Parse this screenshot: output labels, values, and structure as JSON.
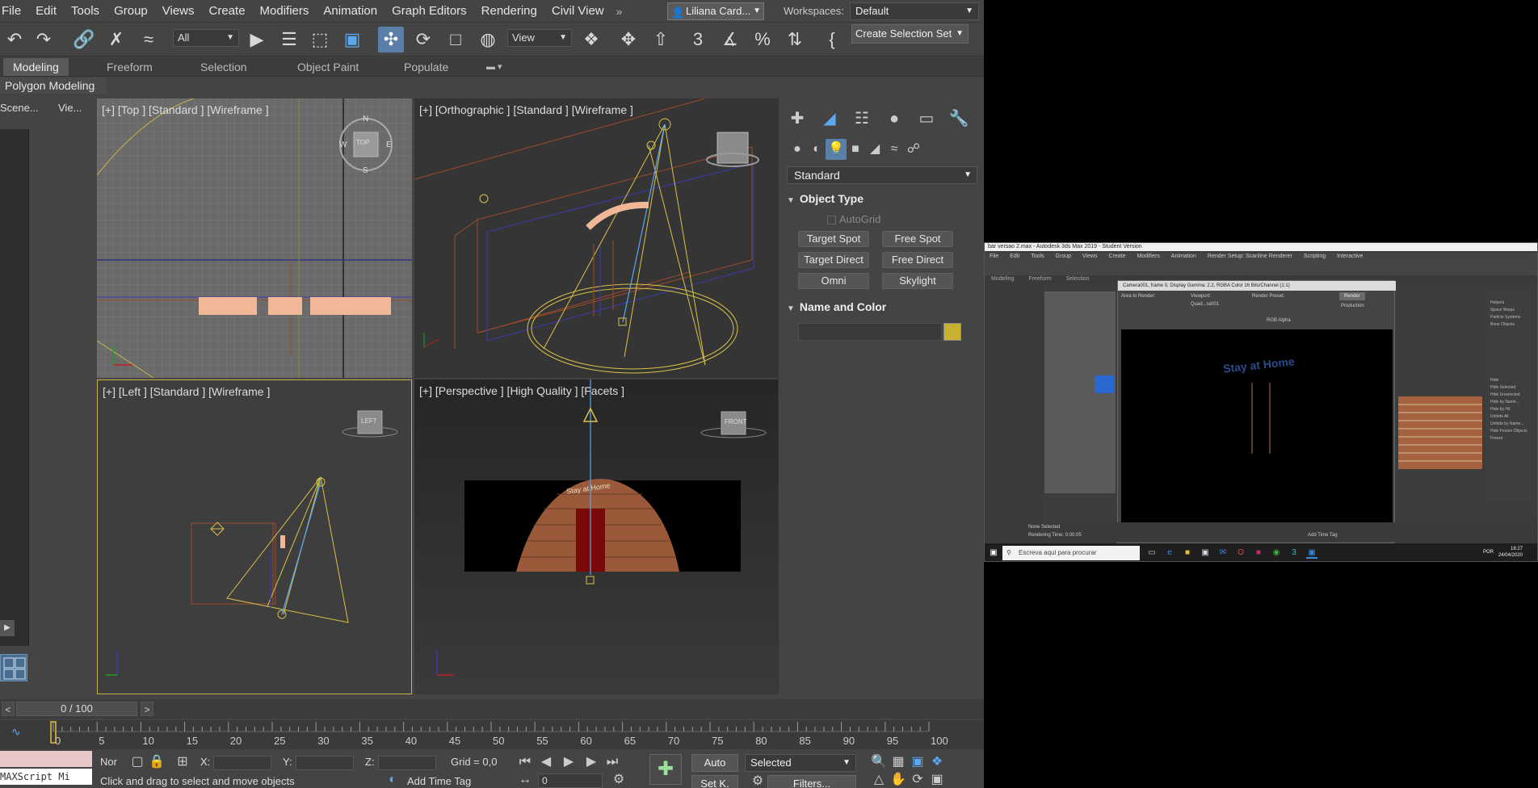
{
  "menu": [
    "File",
    "Edit",
    "Tools",
    "Group",
    "Views",
    "Create",
    "Modifiers",
    "Animation",
    "Graph Editors",
    "Rendering",
    "Civil View"
  ],
  "menu_overflow": "»",
  "user": {
    "name": "Liliana Card..."
  },
  "workspaces": {
    "label": "Workspaces:",
    "value": "Default"
  },
  "toolbar": {
    "selection_filter": "All",
    "ref_coord": "View",
    "create_selection_set": "Create Selection Set",
    "icons": [
      "undo-icon",
      "redo-icon",
      "link-icon",
      "unlink-icon",
      "bind-space-warp-icon",
      "select-object-icon",
      "select-by-name-icon",
      "rectangle-selection-icon",
      "window-crossing-icon",
      "select-move-icon",
      "select-rotate-icon",
      "select-scale-icon",
      "place-icon",
      "pivot-icon",
      "mirror-icon",
      "align-icon",
      "snap-3d-icon",
      "angle-snap-icon",
      "percent-snap-icon",
      "spinner-snap-icon",
      "edit-named-selection-icon"
    ]
  },
  "ribbon": {
    "tabs": [
      "Modeling",
      "Freeform",
      "Selection",
      "Object Paint",
      "Populate"
    ],
    "active": "Modeling",
    "panel_title": "Polygon Modeling"
  },
  "scene_explorer": {
    "tabs": [
      "Scene...",
      "Vie..."
    ]
  },
  "viewports": {
    "top": {
      "label": "[+] [Top ] [Standard ] [Wireframe ]",
      "cube_text": "TOP",
      "compass": [
        "N",
        "S",
        "E",
        "W"
      ]
    },
    "ortho": {
      "label": "[+] [Orthographic ] [Standard ] [Wireframe ]"
    },
    "left": {
      "label": "[+] [Left ] [Standard ] [Wireframe ]",
      "cube_text": "LEFT"
    },
    "persp": {
      "label": "[+] [Perspective ] [High Quality ] [Facets ]",
      "cube_text": "FRONT",
      "sign_text": "Stay at Home"
    }
  },
  "command_panel": {
    "dropdown": "Standard",
    "object_type": {
      "title": "Object Type",
      "autogrid": "AutoGrid",
      "buttons": [
        "Target Spot",
        "Free Spot",
        "Target Direct",
        "Free Direct",
        "Omni",
        "Skylight"
      ]
    },
    "name_and_color": {
      "title": "Name and Color",
      "name_value": "",
      "color": "#c8b12e"
    }
  },
  "time_slider": {
    "value": "0 / 100",
    "prev": "<",
    "next": ">"
  },
  "track": {
    "ticks": [
      "0",
      "5",
      "10",
      "15",
      "20",
      "25",
      "30",
      "35",
      "40",
      "45",
      "50",
      "55",
      "60",
      "65",
      "70",
      "75",
      "80",
      "85",
      "90",
      "95",
      "100"
    ]
  },
  "status": {
    "maxscript": "MAXScript Mi",
    "mode": "Nor",
    "x_label": "X:",
    "y_label": "Y:",
    "z_label": "Z:",
    "grid": "Grid = 0,0",
    "add_time_tag": "Add Time Tag",
    "prompt": "Click and drag to select and move objects",
    "auto_key": "Auto",
    "set_key": "Set K.",
    "key_filter": "Selected",
    "filters": "Filters...",
    "frame": "0"
  },
  "thumbnail": {
    "title": "bar versao 2.max - Autodesk 3ds Max 2019 - Student Version",
    "menu": [
      "File",
      "Edit",
      "Tools",
      "Group",
      "Views",
      "Create",
      "Modifiers",
      "Animation",
      "Render Setup: Scanline Renderer",
      "Scripting",
      "Interactive"
    ],
    "tabs": [
      "Modeling",
      "Freeform",
      "Selection"
    ],
    "render_window_title": "Camera001, frame 0, Display Gamma: 2.2, RGBA Color 16 Bits/Channel (1:1)",
    "area_to_render": "Area to Render:",
    "viewport": "Viewport:",
    "viewport_value": "Quad...ra001",
    "render_preset": "Render Preset:",
    "render_button": "Render",
    "production": "Production",
    "rgb_alpha": "RGB Alpha",
    "render_text": "Stay at Home",
    "none_selected": "None Selected",
    "rendering_time": "Rendering Time: 0:00:05",
    "add_time_tag": "Add Time Tag",
    "search": "Escreva aqui para procurar",
    "clock_time": "18:27",
    "clock_date": "24/04/2020",
    "lang": "POR",
    "right_list": [
      "Helpers",
      "Space Warps",
      "Particle Systems",
      "Bone Objects",
      "Hide",
      "Hide Selected",
      "Hide Unselected",
      "Hide by Name...",
      "Hide by Hit",
      "Unhide All",
      "Unhide by Name...",
      "Hide Frozen Objects",
      "Freeze"
    ]
  }
}
